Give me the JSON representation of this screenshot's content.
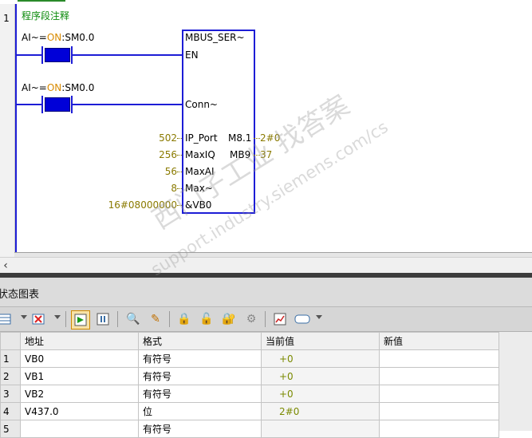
{
  "editor": {
    "rung_number": "1",
    "network_comment": "程序段注释",
    "contact1": {
      "prefix": "AI~=",
      "state": "ON",
      "suffix": ":SM0.0"
    },
    "contact2": {
      "prefix": "AI~=",
      "state": "ON",
      "suffix": ":SM0.0"
    },
    "box": {
      "title": "MBUS_SER~",
      "pins_left": [
        "EN",
        "Conn~",
        "IP_Port",
        "MaxIQ",
        "MaxAI",
        "Max~",
        "&VB0"
      ],
      "pins_right": [
        "M8.1",
        "MB9"
      ]
    },
    "inputs": {
      "ip_port": "502",
      "maxiq": "256",
      "maxai": "56",
      "max": "8",
      "vb0": "16#08000000"
    },
    "outputs": {
      "m81": "2#0",
      "mb9": "37"
    }
  },
  "status_chart": {
    "title": "状态图表",
    "toolbar": [
      {
        "name": "add-row-icon"
      },
      {
        "name": "delete-row-icon"
      },
      {
        "name": "trend-view-icon"
      },
      {
        "name": "pause-icon"
      },
      {
        "name": "read-icon"
      },
      {
        "name": "write-icon"
      },
      {
        "name": "force-icon"
      },
      {
        "name": "unforce-icon"
      },
      {
        "name": "unforce-all-icon"
      },
      {
        "name": "read-forced-icon"
      },
      {
        "name": "chart-icon"
      },
      {
        "name": "display-format-icon"
      }
    ],
    "columns": [
      "地址",
      "格式",
      "当前值",
      "新值"
    ],
    "rows": [
      {
        "num": "1",
        "address": "VB0",
        "format": "有符号",
        "current": "+0",
        "new": ""
      },
      {
        "num": "2",
        "address": "VB1",
        "format": "有符号",
        "current": "+0",
        "new": ""
      },
      {
        "num": "3",
        "address": "VB2",
        "format": "有符号",
        "current": "+0",
        "new": ""
      },
      {
        "num": "4",
        "address": "V437.0",
        "format": "位",
        "current": "2#0",
        "new": ""
      },
      {
        "num": "5",
        "address": "",
        "format": "有符号",
        "current": "",
        "new": ""
      }
    ]
  },
  "watermark": {
    "line1": "西门子工业  找答案",
    "line2": "support.industry.siemens.com/cs"
  }
}
